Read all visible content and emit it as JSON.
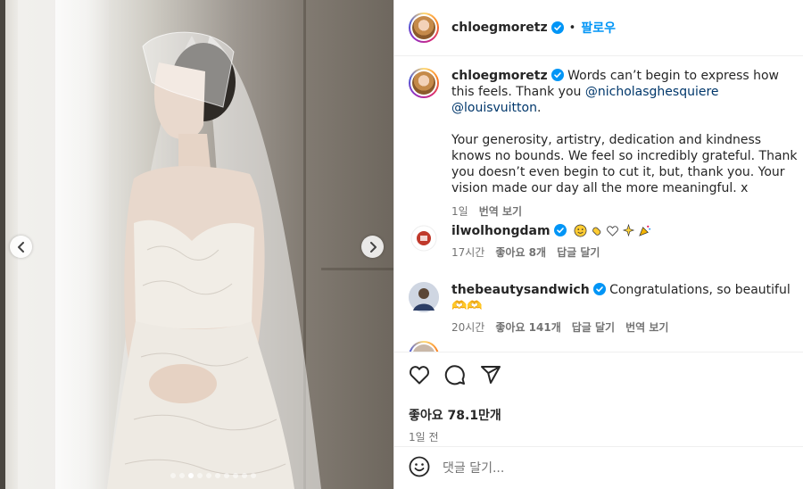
{
  "post": {
    "username": "chloegmoretz",
    "follow_label": "팔로우",
    "separator": "•"
  },
  "caption": {
    "username": "chloegmoretz",
    "line1": "Words can’t begin to express how this feels.",
    "thank_you": "Thank you ",
    "mention1": "@nicholasghesquiere",
    "mention2": "@louisvuitton",
    "period": ".",
    "paragraph": "Your generosity, artistry, dedication and kindness knows no bounds. We feel so incredibly grateful. Thank you doesn’t even begin to cut it, but, thank you. Your vision made our day all the more meaningful. x",
    "time": "1일",
    "translate": "번역 보기"
  },
  "comments": [
    {
      "username": "ilwolhongdam",
      "text": "",
      "time": "17시간",
      "likes": "좋아요 8개",
      "reply": "답글 달기",
      "translate": ""
    },
    {
      "username": "thebeautysandwich",
      "text": "Congratulations, so beautiful 🫶🫶",
      "time": "20시간",
      "likes": "좋아요 141개",
      "reply": "답글 달기",
      "translate": "번역 보기"
    }
  ],
  "stats": {
    "likes": "좋아요 78.1만개",
    "posted": "1일 전"
  },
  "composer": {
    "placeholder": "댓글 달기..."
  },
  "carousel": {
    "total": 10,
    "active_index": 2
  },
  "icons": [
    "heart-icon",
    "comment-icon",
    "share-icon",
    "emoji-icon",
    "verified-icon",
    "chevron-left-icon",
    "chevron-right-icon"
  ],
  "colors": {
    "follow": "#0095f6",
    "verified": "#0095f6",
    "mention": "#00376b",
    "muted": "#737373"
  }
}
